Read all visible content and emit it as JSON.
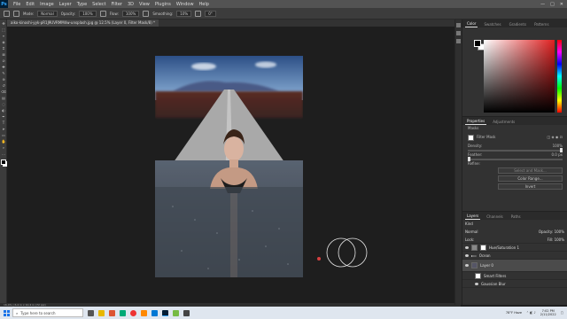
{
  "app": {
    "logo": "Ps"
  },
  "menu": [
    "File",
    "Edit",
    "Image",
    "Layer",
    "Type",
    "Select",
    "Filter",
    "3D",
    "View",
    "Plugins",
    "Window",
    "Help"
  ],
  "window_controls": [
    "—",
    "□",
    "✕"
  ],
  "options": {
    "mode_label": "Mode:",
    "mode_value": "Normal",
    "opacity_label": "Opacity:",
    "opacity_value": "100%",
    "flow_label": "Flow:",
    "flow_value": "100%",
    "smoothing_label": "Smoothing:",
    "smoothing_value": "10%",
    "angle_value": "0°"
  },
  "document_tab": "aiko-kinoshi-yyk-pR1J9UVRMM4w-unsplash.jpg @ 12.5% (Layer 0, Filter Mask/8) *",
  "status_text": "16.4%  |  6.4 in x 10.4 in (72 ppi)",
  "tools": [
    "move-icon",
    "marquee-icon",
    "lasso-icon",
    "select-icon",
    "crop-icon",
    "frame-icon",
    "eyedropper-icon",
    "healing-icon",
    "brush-icon",
    "stamp-icon",
    "history-brush-icon",
    "eraser-icon",
    "gradient-icon",
    "blur-icon",
    "dodge-icon",
    "pen-icon",
    "type-icon",
    "path-select-icon",
    "shape-icon",
    "hand-icon",
    "zoom-icon",
    "more-icon"
  ],
  "color_panel": {
    "tabs": [
      "Color",
      "Swatches",
      "Gradients",
      "Patterns"
    ],
    "active": "Color",
    "fg": "#000000",
    "bg": "#ffffff"
  },
  "properties": {
    "tabs": [
      "Properties",
      "Adjustments"
    ],
    "section": "Masks",
    "mask_label": "Filter Mask",
    "density_label": "Density:",
    "density_value": "100%",
    "feather_label": "Feather:",
    "feather_value": "0.0 px",
    "refine_label": "Refine:",
    "select_button": "Select and Mask...",
    "color_range_button": "Color Range...",
    "invert_button": "Invert"
  },
  "layers_panel": {
    "tabs": [
      "Layers",
      "Channels",
      "Paths"
    ],
    "kind_label": "Kind",
    "blend": "Normal",
    "opacity_label": "Opacity:",
    "opacity_value": "100%",
    "lock_label": "Lock:",
    "fill_label": "Fill:",
    "fill_value": "100%",
    "layers": [
      {
        "name": "Hue/Saturation 1"
      },
      {
        "name": "Ocean"
      },
      {
        "name": "Layer 0"
      },
      {
        "name": "Smart Filters"
      },
      {
        "name": "Gaussian Blur"
      }
    ]
  },
  "taskbar": {
    "search_placeholder": "Type here to search",
    "weather": "78°F Haze",
    "time": "7:02 PM",
    "date": "2/11/2022"
  }
}
